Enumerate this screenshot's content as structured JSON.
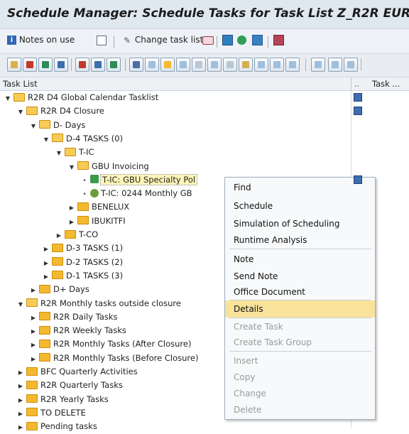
{
  "window": {
    "title": "Schedule Manager: Schedule Tasks for Task List Z_R2R EUR"
  },
  "toolbar1": {
    "notes_label": "Notes on use",
    "change_label": "Change task list"
  },
  "columns": {
    "task_list": "Task List",
    "c2": "..",
    "task": "Task ..."
  },
  "tree": [
    {
      "label": "R2R D4 Global Calendar Tasklist",
      "type": "folder-open"
    },
    {
      "label": "R2R D4 Closure",
      "type": "folder-open"
    },
    {
      "label": "D- Days",
      "type": "folder-open"
    },
    {
      "label": "D-4 TASKS (0)",
      "type": "folder-open"
    },
    {
      "label": "T-IC",
      "type": "folder-open"
    },
    {
      "label": "GBU Invoicing",
      "type": "folder-open"
    },
    {
      "label": "T-IC: GBU Specialty Pol",
      "type": "task-selected"
    },
    {
      "label": "T-IC: 0244 Monthly GB",
      "type": "task"
    },
    {
      "label": "BENELUX",
      "type": "folder"
    },
    {
      "label": "IBUKITFI",
      "type": "folder"
    },
    {
      "label": "T-CO",
      "type": "folder"
    },
    {
      "label": "D-3 TASKS (1)",
      "type": "folder"
    },
    {
      "label": "D-2 TASKS (2)",
      "type": "folder"
    },
    {
      "label": "D-1 TASKS (3)",
      "type": "folder"
    },
    {
      "label": "D+ Days",
      "type": "folder"
    },
    {
      "label": "R2R Monthly tasks outside closure",
      "type": "folder-open"
    },
    {
      "label": "R2R Daily Tasks",
      "type": "folder"
    },
    {
      "label": "R2R Weekly Tasks",
      "type": "folder"
    },
    {
      "label": "R2R Monthly Tasks (After Closure)",
      "type": "folder"
    },
    {
      "label": "R2R Monthly Tasks (Before Closure)",
      "type": "folder"
    },
    {
      "label": "BFC Quarterly Activities",
      "type": "folder"
    },
    {
      "label": "R2R Quarterly Tasks",
      "type": "folder"
    },
    {
      "label": "R2R Yearly Tasks",
      "type": "folder"
    },
    {
      "label": "TO DELETE",
      "type": "folder"
    },
    {
      "label": "Pending tasks",
      "type": "folder"
    }
  ],
  "context_menu": {
    "find": "Find",
    "schedule": "Schedule",
    "simulation": "Simulation of Scheduling",
    "runtime": "Runtime Analysis",
    "note": "Note",
    "send_note": "Send Note",
    "office_doc": "Office Document",
    "details": "Details",
    "create_task": "Create Task",
    "create_task_group": "Create Task Group",
    "insert": "Insert",
    "copy": "Copy",
    "change": "Change",
    "delete": "Delete"
  },
  "colors": {
    "accent": "#f9e29a",
    "folder": "#f3b92f",
    "cell_icon": "#3f6db1"
  }
}
